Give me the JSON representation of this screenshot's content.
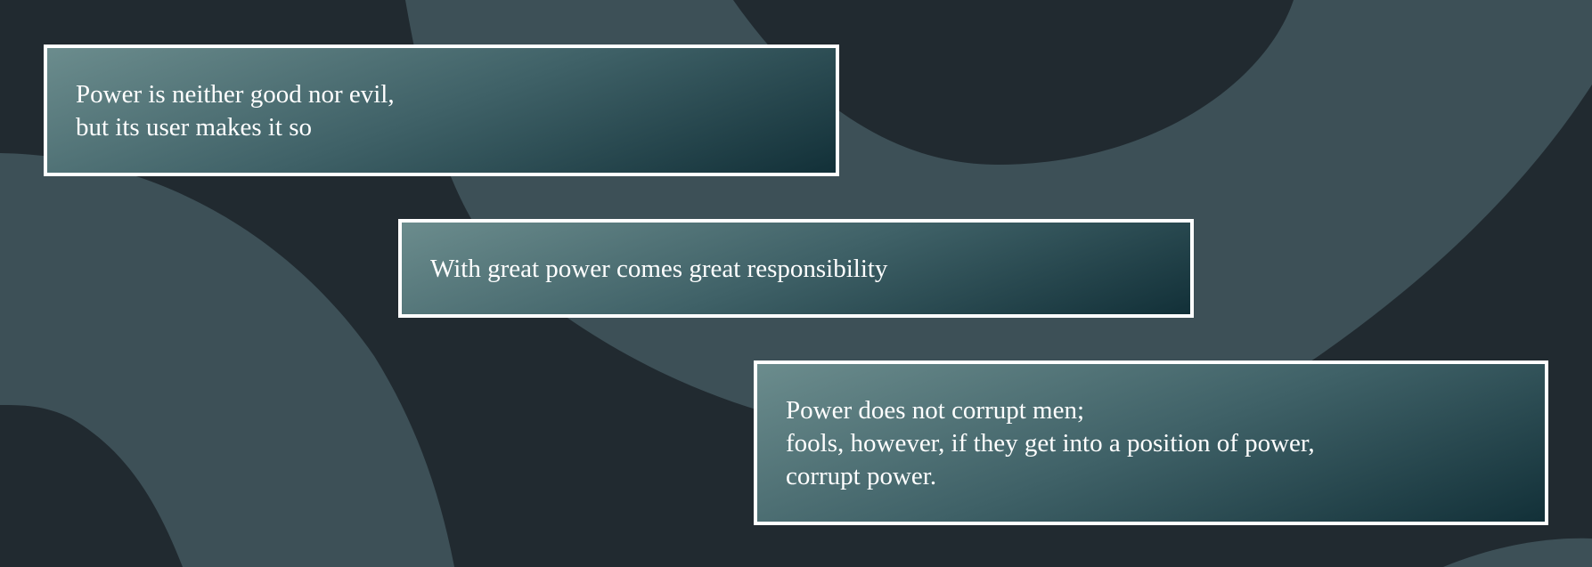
{
  "colors": {
    "background": "#212a30",
    "band": "#3d5057",
    "box_border": "#ffffff",
    "box_gradient_light": "#6b8c8d",
    "box_gradient_dark": "#123038",
    "text": "#ffffff"
  },
  "quotes": [
    {
      "lines": [
        "Power is neither good nor evil,",
        "but its user makes it so"
      ]
    },
    {
      "lines": [
        "With great power comes great responsibility"
      ]
    },
    {
      "lines": [
        "Power does not corrupt men;",
        "fools, however, if they get into a position of power,",
        "corrupt power."
      ]
    }
  ]
}
